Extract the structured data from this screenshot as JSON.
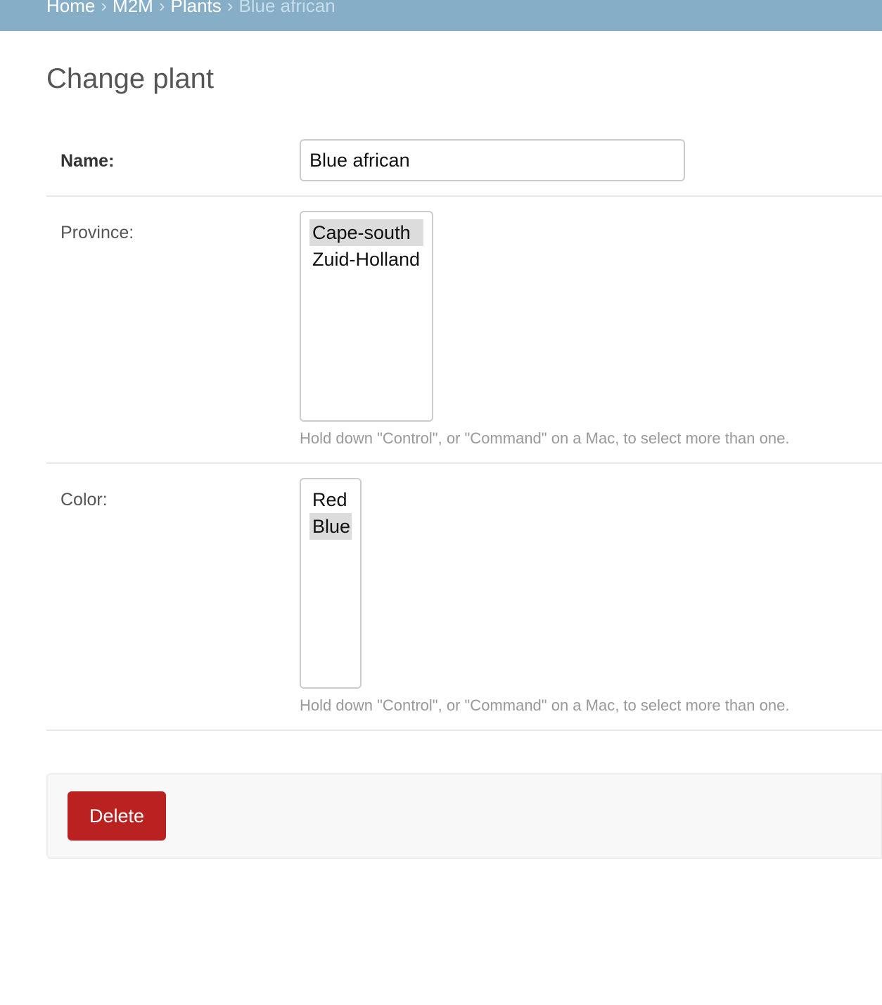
{
  "breadcrumbs": {
    "home": "Home",
    "app": "M2M",
    "model": "Plants",
    "current": "Blue african",
    "separator": "›"
  },
  "page": {
    "title": "Change plant"
  },
  "form": {
    "name": {
      "label": "Name:",
      "value": "Blue african"
    },
    "province": {
      "label": "Province:",
      "options": [
        {
          "label": "Cape-south",
          "selected": true
        },
        {
          "label": "Zuid-Holland",
          "selected": false
        }
      ],
      "help": "Hold down \"Control\", or \"Command\" on a Mac, to select more than one."
    },
    "color": {
      "label": "Color:",
      "options": [
        {
          "label": "Red",
          "selected": false
        },
        {
          "label": "Blue",
          "selected": true
        }
      ],
      "help": "Hold down \"Control\", or \"Command\" on a Mac, to select more than one."
    }
  },
  "actions": {
    "delete_label": "Delete"
  },
  "colors": {
    "header_bg": "#86aec7",
    "delete_bg": "#ba2121",
    "selected_option_bg": "#dcdcdc"
  }
}
